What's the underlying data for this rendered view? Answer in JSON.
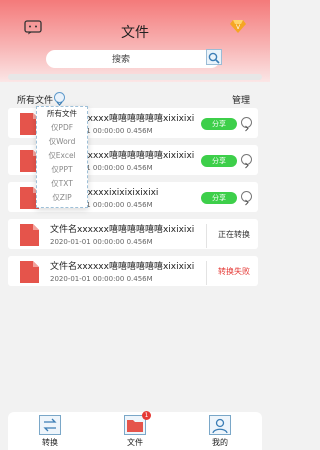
{
  "header": {
    "title": "文件",
    "search_label": "搜索",
    "accent": "#f47a7a"
  },
  "toolbar": {
    "filter_label": "所有文件",
    "manage_label": "管理"
  },
  "dropdown": {
    "items": [
      "所有文件",
      "仅PDF",
      "仅Word",
      "仅Excel",
      "仅PPT",
      "仅TXT",
      "仅ZIP"
    ]
  },
  "files": [
    {
      "name": "文件名xxxxxx嘻嘻嘻嘻嘻嘻xixixixi",
      "meta": "2020-01-01  00:00:00  0.456M",
      "action": "分享"
    },
    {
      "name": "文件名xxxxxx嘻嘻嘻嘻嘻嘻xixixixi",
      "meta": "2020-01-01  00:00:00  0.456M",
      "action": "分享"
    },
    {
      "name": "文件名xxxxxxixixixixixixi",
      "meta": "2020-01-01  00:00:00  0.456M",
      "action": "分享"
    },
    {
      "name": "文件名xxxxxx嘻嘻嘻嘻嘻嘻xixixixi",
      "meta": "2020-01-01  00:00:00  0.456M",
      "status": "正在转换",
      "status_color": "#333333"
    },
    {
      "name": "文件名xxxxxx嘻嘻嘻嘻嘻嘻xixixixi",
      "meta": "2020-01-01  00:00:00  0.456M",
      "status": "转换失败",
      "status_color": "#e53935"
    }
  ],
  "tabs": [
    {
      "label": "转换",
      "icon": "convert-icon"
    },
    {
      "label": "文件",
      "icon": "folder-icon",
      "badge": "1"
    },
    {
      "label": "我的",
      "icon": "profile-icon"
    }
  ],
  "colors": {
    "share_green": "#3dcf4a",
    "file_red": "#e5544b",
    "fail_red": "#e53935"
  }
}
